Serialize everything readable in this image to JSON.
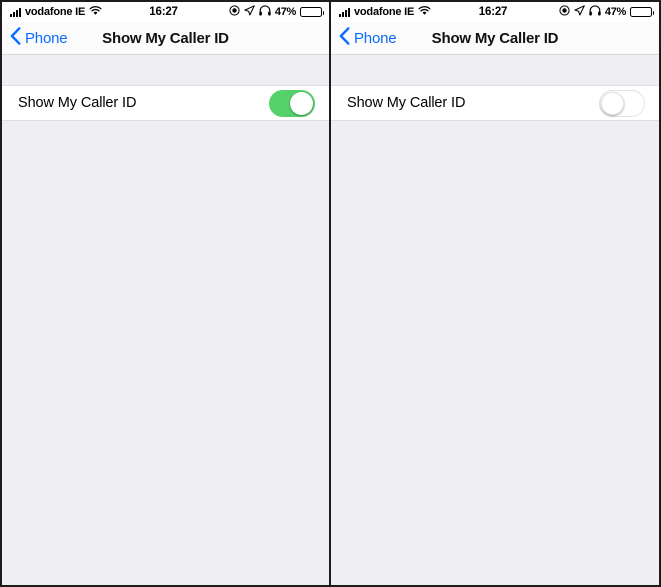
{
  "panels": [
    {
      "id": "left",
      "status_bar": {
        "carrier": "vodafone IE",
        "signal_icon": "signal-bars-icon",
        "wifi_icon": "wifi-icon",
        "time": "16:27",
        "dnd_icon": "do-not-disturb-icon",
        "location_icon": "location-arrow-icon",
        "headphones_icon": "headphones-icon",
        "battery_percent": "47%",
        "battery_icon": "battery-icon",
        "battery_level": 47
      },
      "nav_bar": {
        "back_icon": "chevron-left-icon",
        "back_label": "Phone",
        "title": "Show My Caller ID"
      },
      "rows": [
        {
          "label": "Show My Caller ID",
          "toggle_state": "on",
          "toggle_name": "show-my-caller-id-toggle"
        }
      ]
    },
    {
      "id": "right",
      "status_bar": {
        "carrier": "vodafone IE",
        "signal_icon": "signal-bars-icon",
        "wifi_icon": "wifi-icon",
        "time": "16:27",
        "dnd_icon": "do-not-disturb-icon",
        "location_icon": "location-arrow-icon",
        "headphones_icon": "headphones-icon",
        "battery_percent": "47%",
        "battery_icon": "battery-icon",
        "battery_level": 47
      },
      "nav_bar": {
        "back_icon": "chevron-left-icon",
        "back_label": "Phone",
        "title": "Show My Caller ID"
      },
      "rows": [
        {
          "label": "Show My Caller ID",
          "toggle_state": "off",
          "toggle_name": "show-my-caller-id-toggle"
        }
      ]
    }
  ],
  "colors": {
    "accent_blue": "#0a6cff",
    "toggle_on_green": "#55d16a",
    "page_background": "#efeef3",
    "row_background": "#ffffff",
    "separator": "#dededf",
    "frame_border": "#1c1c1e"
  }
}
